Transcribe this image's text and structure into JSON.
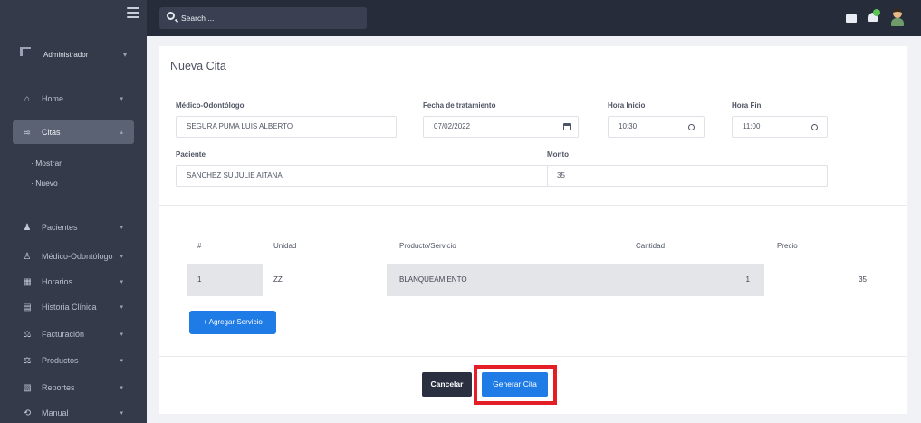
{
  "sidebar": {
    "user_label": "Administrador",
    "items": [
      {
        "label": "Home",
        "icon": "home-icon",
        "glyph": "⌂"
      },
      {
        "label": "Citas",
        "icon": "layers-icon",
        "glyph": "≋"
      },
      {
        "label": "Pacientes",
        "icon": "person-icon",
        "glyph": "♟"
      },
      {
        "label": "Médico-Odontólogo",
        "icon": "doctor-icon",
        "glyph": "♙"
      },
      {
        "label": "Horarios",
        "icon": "calendar-icon",
        "glyph": "▦"
      },
      {
        "label": "Historia Clínica",
        "icon": "clipboard-icon",
        "glyph": "▤"
      },
      {
        "label": "Facturación",
        "icon": "scale-icon",
        "glyph": "⚖"
      },
      {
        "label": "Productos",
        "icon": "scale-icon",
        "glyph": "⚖"
      },
      {
        "label": "Reportes",
        "icon": "report-icon",
        "glyph": "▧"
      },
      {
        "label": "Manual",
        "icon": "manual-icon",
        "glyph": "⟲"
      }
    ],
    "sub_items": [
      "Mostrar",
      "Nuevo"
    ]
  },
  "header": {
    "search_placeholder": "Search ..."
  },
  "form": {
    "title": "Nueva Cita",
    "medico_label": "Médico-Odontólogo",
    "medico_value": "SEGURA PUMA LUIS ALBERTO",
    "fecha_label": "Fecha de tratamiento",
    "fecha_value": "07/02/2022",
    "hora_inicio_label": "Hora Inicio",
    "hora_inicio_value": "10:30",
    "hora_fin_label": "Hora Fin",
    "hora_fin_value": "11:00",
    "paciente_label": "Paciente",
    "paciente_value": "SANCHEZ SU JULIE AITANA",
    "monto_label": "Monto",
    "monto_value": "35"
  },
  "table": {
    "headers": [
      "#",
      "Unidad",
      "Producto/Servicio",
      "Cantidad",
      "Precio"
    ],
    "rows": [
      [
        "1",
        "ZZ",
        "BLANQUEAMIENTO",
        "1",
        "35"
      ]
    ]
  },
  "buttons": {
    "add_service": "+ Agregar Servicio",
    "cancel": "Cancelar",
    "generate": "Generar Cita"
  },
  "colors": {
    "primary": "#1f7be6",
    "highlight": "#e41e26",
    "sidebar": "#343a4a"
  }
}
